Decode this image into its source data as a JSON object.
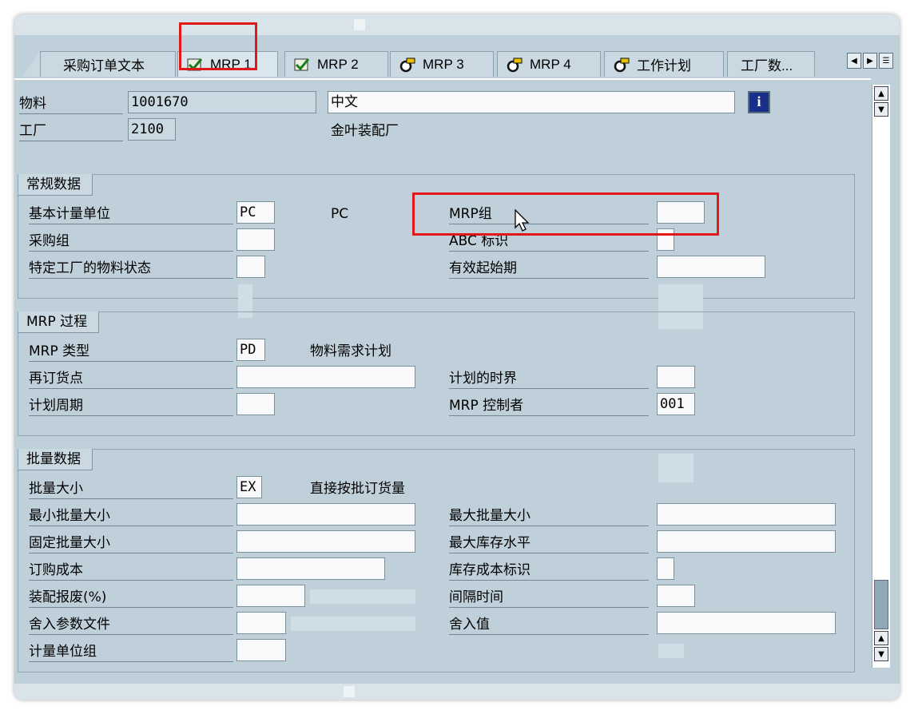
{
  "tabs": [
    {
      "label": "采购订单文本",
      "icon": "none"
    },
    {
      "label": "MRP 1",
      "icon": "check-icon",
      "active": true
    },
    {
      "label": "MRP 2",
      "icon": "check-icon"
    },
    {
      "label": "MRP 3",
      "icon": "edit-icon"
    },
    {
      "label": "MRP 4",
      "icon": "edit-icon"
    },
    {
      "label": "工作计划",
      "icon": "edit-icon"
    },
    {
      "label": "工厂数...",
      "icon": "none"
    }
  ],
  "header": {
    "material_label": "物料",
    "material_value": "1001670",
    "material_desc": "中文",
    "plant_label": "工厂",
    "plant_value": "2100",
    "plant_desc": "金叶装配厂",
    "info_button": "i"
  },
  "general": {
    "title": "常规数据",
    "base_uom_label": "基本计量单位",
    "base_uom_value": "PC",
    "base_uom_text": "PC",
    "purchasing_group_label": "采购组",
    "plant_status_label": "特定工厂的物料状态",
    "mrp_group_label": "MRP组",
    "abc_label": "ABC 标识",
    "valid_from_label": "有效起始期"
  },
  "mrp_procedure": {
    "title": "MRP 过程",
    "mrp_type_label": "MRP 类型",
    "mrp_type_value": "PD",
    "mrp_type_text": "物料需求计划",
    "reorder_label": "再订货点",
    "time_fence_label": "计划的时界",
    "cycle_label": "计划周期",
    "controller_label": "MRP 控制者",
    "controller_value": "001"
  },
  "lot_size": {
    "title": "批量数据",
    "lot_size_label": "批量大小",
    "lot_size_value": "EX",
    "lot_size_text": "直接按批订货量",
    "min_label": "最小批量大小",
    "max_label": "最大批量大小",
    "fixed_label": "固定批量大小",
    "max_stock_label": "最大库存水平",
    "order_cost_label": "订购成本",
    "storage_cost_label": "库存成本标识",
    "scrap_label": "装配报废(%)",
    "takt_label": "间隔时间",
    "rounding_profile_label": "舍入参数文件",
    "rounding_value_label": "舍入值",
    "uom_group_label": "计量单位组"
  },
  "colors": {
    "highlight": "#e01818",
    "background": "#bfd0da"
  }
}
